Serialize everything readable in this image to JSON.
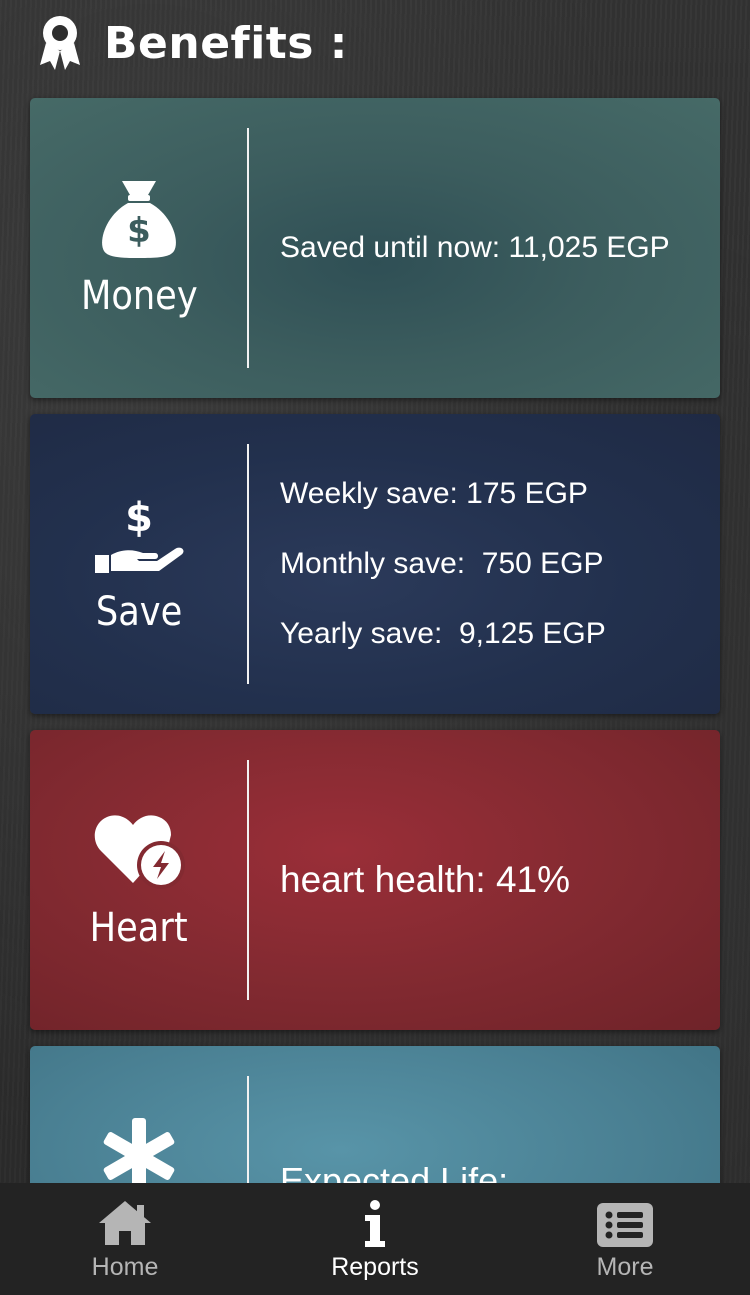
{
  "header": {
    "title": "Benefits :",
    "icon": "award-icon"
  },
  "cards": {
    "money": {
      "icon": "money-bag-icon",
      "label": "Money",
      "lines": [
        "Saved until now: 11,025 EGP"
      ],
      "color": "#3c5d5e"
    },
    "save": {
      "icon": "hand-dollar-icon",
      "label": "Save",
      "lines": [
        "Weekly save: 175 EGP",
        "Monthly save:  750 EGP",
        "Yearly save:  9,125 EGP"
      ],
      "color": "#22304d"
    },
    "heart": {
      "icon": "heart-bolt-icon",
      "label": "Heart",
      "lines": [
        "heart health: 41%"
      ],
      "color": "#832a31"
    },
    "life": {
      "icon": "asterisk-icon",
      "label": "",
      "lines": [
        "Expected Life:"
      ],
      "color": "#4a8093"
    }
  },
  "bottom_nav": {
    "items": [
      {
        "label": "Home",
        "icon": "home-icon",
        "active": false
      },
      {
        "label": "Reports",
        "icon": "info-icon",
        "active": true
      },
      {
        "label": "More",
        "icon": "list-icon",
        "active": false
      }
    ]
  }
}
